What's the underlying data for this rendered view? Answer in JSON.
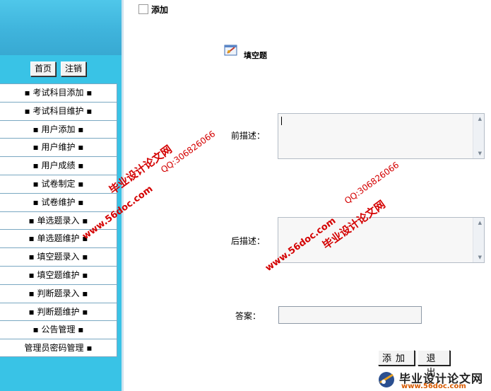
{
  "sidebar": {
    "home_button": "首页",
    "logout_button": "注销",
    "menu": [
      "▪ 考试科目添加 ▪",
      "▪ 考试科目维护 ▪",
      "▪ 用户添加 ▪",
      "▪ 用户维护 ▪",
      "▪ 用户成绩 ▪",
      "▪ 试卷制定 ▪",
      "▪ 试卷维护 ▪",
      "▪ 单选题录入 ▪",
      "▪ 单选题维护 ▪",
      "▪ 填空题录入 ▪",
      "▪ 填空题维护 ▪",
      "▪ 判断题录入 ▪",
      "▪ 判断题维护 ▪",
      "▪ 公告管理 ▪",
      "管理员密码管理 ▪"
    ]
  },
  "main": {
    "header_title": "添加",
    "question_type": "填空题",
    "pre_label": "前描述：",
    "post_label": "后描述：",
    "answer_label": "答案：",
    "add_button": "添加",
    "exit_button": "退出"
  },
  "watermarks": {
    "site_name": "毕业设计论文网",
    "site_url": "www.56doc.com",
    "qq": "QQ:306826066"
  },
  "brand": {
    "name": "毕业设计论文网",
    "url": "www.56doc.com"
  },
  "colors": {
    "sidebar_bg": "#39c3e6",
    "watermark": "#d40000"
  }
}
